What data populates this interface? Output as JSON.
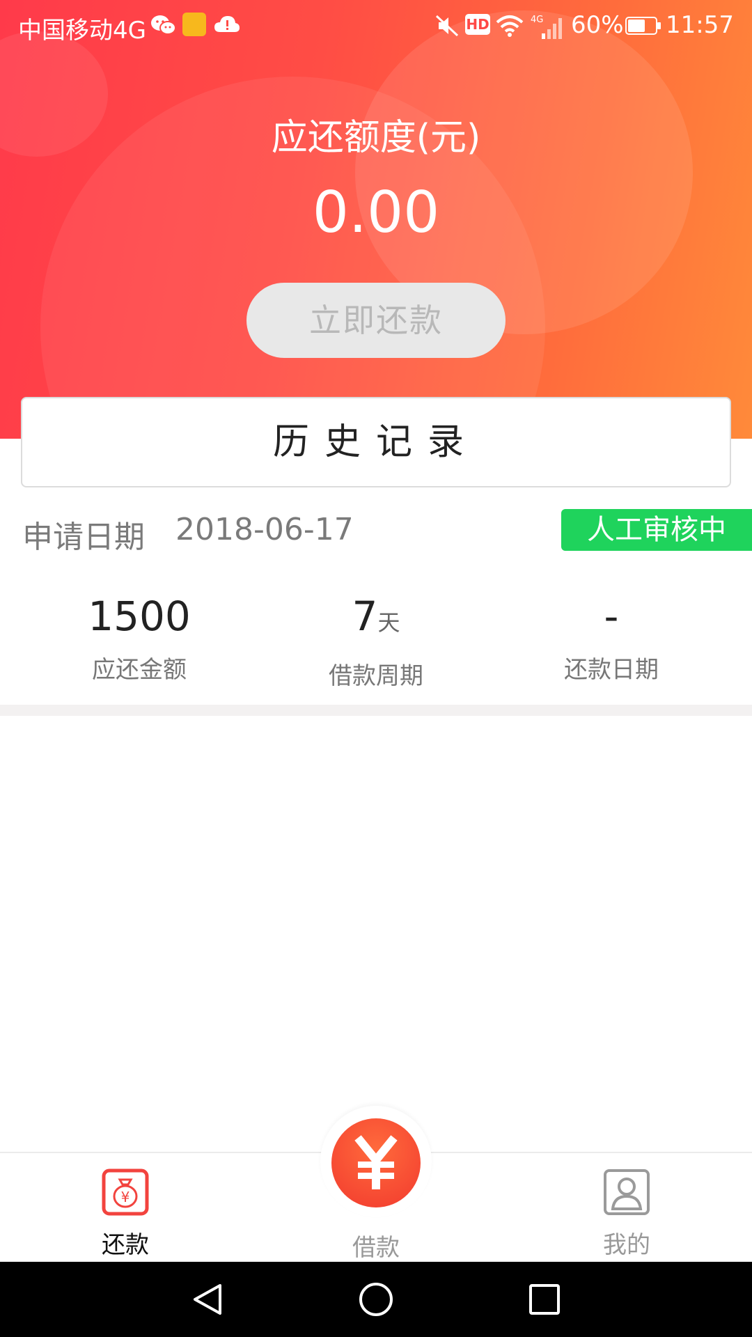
{
  "status_bar": {
    "carrier": "中国移动4G",
    "hd_label": "HD",
    "signal_label": "4G",
    "battery": "60%",
    "time": "11:57"
  },
  "hero": {
    "title": "应还额度(元)",
    "amount": "0.00",
    "pay_button": "立即还款"
  },
  "history_button": "历史记录",
  "application": {
    "date_label": "申请日期",
    "date": "2018-06-17",
    "status": "人工审核中"
  },
  "stats": [
    {
      "value": "1500",
      "unit": "",
      "label": "应还金额"
    },
    {
      "value": "7",
      "unit": "天",
      "label": "借款周期"
    },
    {
      "value": "-",
      "unit": "",
      "label": "还款日期"
    }
  ],
  "tabs": {
    "repay": "还款",
    "borrow": "借款",
    "mine": "我的"
  },
  "colors": {
    "accent": "#ff4846",
    "status_green": "#1fd35c",
    "disabled_button": "#e8e8e8"
  }
}
